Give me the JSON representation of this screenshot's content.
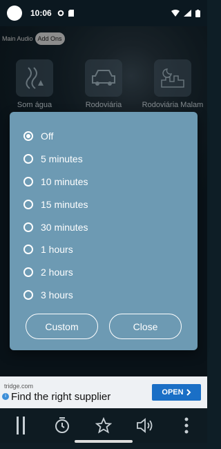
{
  "status_bar": {
    "time": "10:06"
  },
  "tabs": {
    "main_audio": "Main Audio",
    "add_ons": "Add Ons"
  },
  "sounds": [
    {
      "label": "Som água",
      "icon": "river-icon"
    },
    {
      "label": "Rodoviária",
      "icon": "car-icon"
    },
    {
      "label": "Rodoviária Malam",
      "icon": "night-city-icon"
    }
  ],
  "timer_dialog": {
    "options": [
      {
        "label": "Off",
        "selected": true
      },
      {
        "label": "5 minutes",
        "selected": false
      },
      {
        "label": "10 minutes",
        "selected": false
      },
      {
        "label": "15 minutes",
        "selected": false
      },
      {
        "label": "30 minutes",
        "selected": false
      },
      {
        "label": "1 hours",
        "selected": false
      },
      {
        "label": "2 hours",
        "selected": false
      },
      {
        "label": "3 hours",
        "selected": false
      }
    ],
    "custom_label": "Custom",
    "close_label": "Close"
  },
  "ad": {
    "domain": "tridge.com",
    "title": "Find the right supplier",
    "open_label": "OPEN"
  },
  "bottom_bar": [
    "pause-icon",
    "timer-icon",
    "star-icon",
    "volume-icon",
    "more-vert-icon"
  ],
  "colors": {
    "dialog_bg": "#6d9ab3",
    "ad_button": "#1a6fc6"
  }
}
